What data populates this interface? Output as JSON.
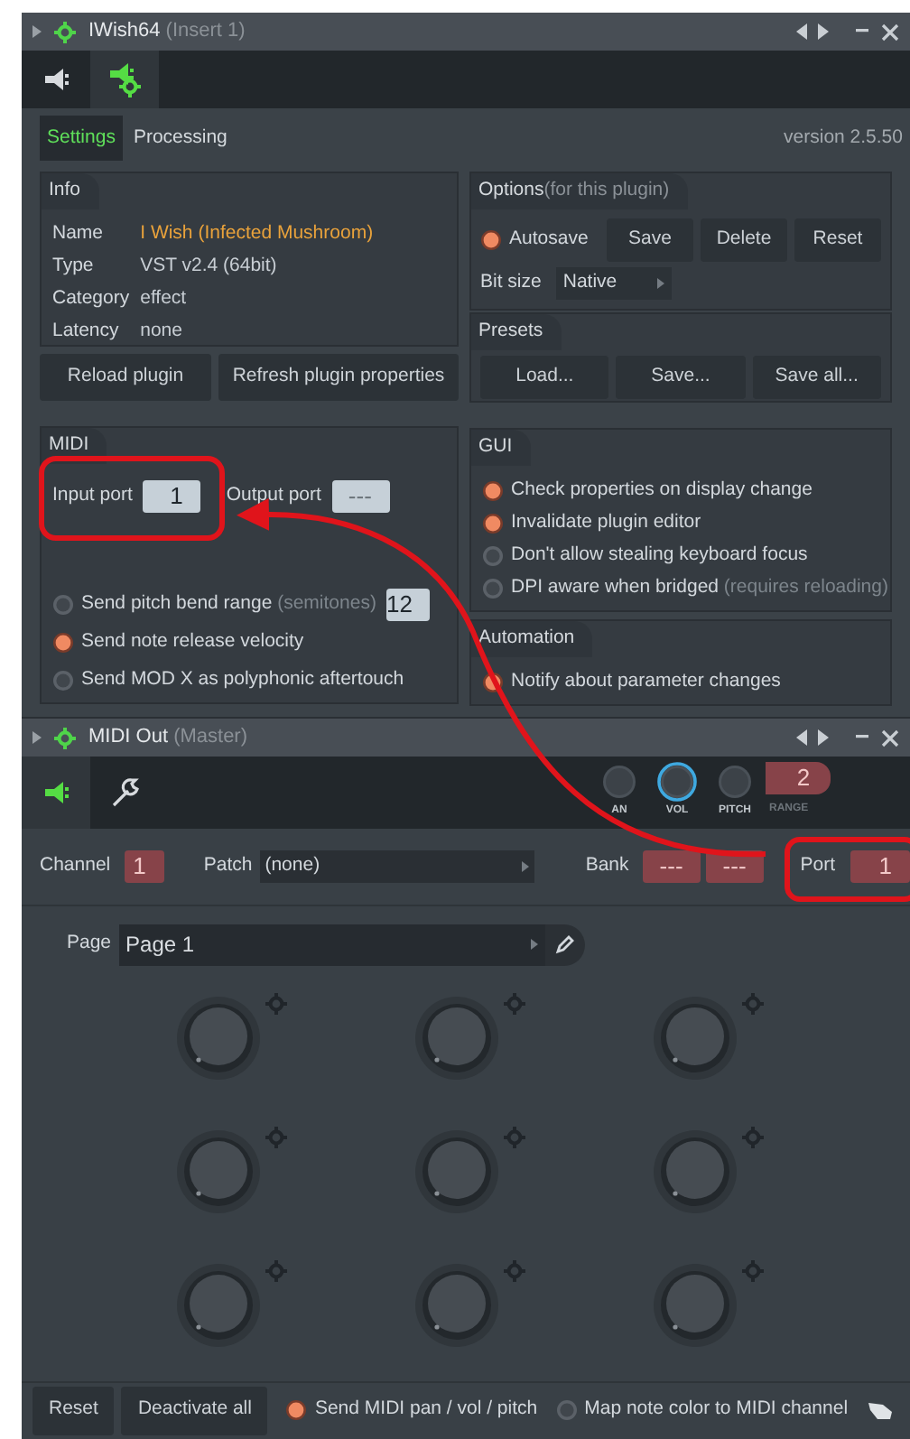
{
  "plugin_window": {
    "title": "IWish64",
    "subtitle": "(Insert 1)",
    "toolbar": [
      {
        "kind": "plug",
        "selected": false
      },
      {
        "kind": "plug-gear",
        "selected": true
      }
    ],
    "tabs": [
      {
        "label": "Settings",
        "selected": true
      },
      {
        "label": "Processing",
        "selected": false
      }
    ],
    "version": "version 2.5.50",
    "info": {
      "title": "Info",
      "rows": [
        {
          "label": "Name",
          "value": "I Wish (Infected Mushroom)",
          "color": "#e9a23b"
        },
        {
          "label": "Type",
          "value": "VST v2.4 (64bit)",
          "color": "#c8ced4"
        },
        {
          "label": "Category",
          "value": "effect",
          "color": "#c8ced4"
        },
        {
          "label": "Latency",
          "value": "none",
          "color": "#c8ced4"
        }
      ]
    },
    "buttons": [
      "Reload plugin",
      "Refresh plugin properties"
    ],
    "options": {
      "title": "Options",
      "note": "(for this plugin)",
      "autosave": {
        "label": "Autosave",
        "on": true
      },
      "buttons": [
        "Save",
        "Delete",
        "Reset"
      ],
      "bit_size": {
        "label": "Bit size",
        "value": "Native"
      }
    },
    "presets": {
      "title": "Presets",
      "buttons": [
        "Load...",
        "Save...",
        "Save all..."
      ]
    },
    "midi": {
      "title": "MIDI",
      "input_port": {
        "label": "Input port",
        "value": "1"
      },
      "output_port": {
        "label": "Output port",
        "value": "---"
      },
      "options": [
        {
          "label": "Send pitch bend range",
          "note": "(semitones)",
          "on": false,
          "value": "12"
        },
        {
          "label": "Send note release velocity",
          "on": true
        },
        {
          "label": "Send MOD X as polyphonic aftertouch",
          "on": false
        }
      ]
    },
    "gui": {
      "title": "GUI",
      "options": [
        {
          "label": "Check properties on display change",
          "on": true
        },
        {
          "label": "Invalidate plugin editor",
          "on": true
        },
        {
          "label": "Don't allow stealing keyboard focus",
          "on": false
        },
        {
          "label": "DPI aware when bridged",
          "note": "(requires reloading)",
          "on": false
        }
      ]
    },
    "automation": {
      "title": "Automation",
      "options": [
        {
          "label": "Notify about parameter changes",
          "on": true
        }
      ]
    }
  },
  "midi_out_window": {
    "title": "MIDI Out",
    "subtitle": "(Master)",
    "toolbar": [
      {
        "kind": "plug",
        "selected": true
      },
      {
        "kind": "wrench",
        "selected": false
      }
    ],
    "knobs": [
      {
        "label": "AN",
        "kind": "plain"
      },
      {
        "label": "VOL",
        "kind": "active"
      },
      {
        "label": "PITCH",
        "kind": "plain"
      }
    ],
    "range": {
      "value": "2",
      "label": "RANGE"
    },
    "channel": {
      "label": "Channel",
      "value": "1"
    },
    "patch": {
      "label": "Patch",
      "value": "(none)"
    },
    "bank": {
      "label": "Bank",
      "values": [
        "---",
        "---"
      ]
    },
    "port": {
      "label": "Port",
      "value": "1"
    },
    "page": {
      "label": "Page",
      "value": "Page 1"
    },
    "footer": {
      "buttons": [
        "Reset",
        "Deactivate all"
      ],
      "options": [
        {
          "label": "Send MIDI pan / vol / pitch",
          "on": true
        },
        {
          "label": "Map note color to MIDI channel",
          "on": false
        }
      ]
    }
  }
}
